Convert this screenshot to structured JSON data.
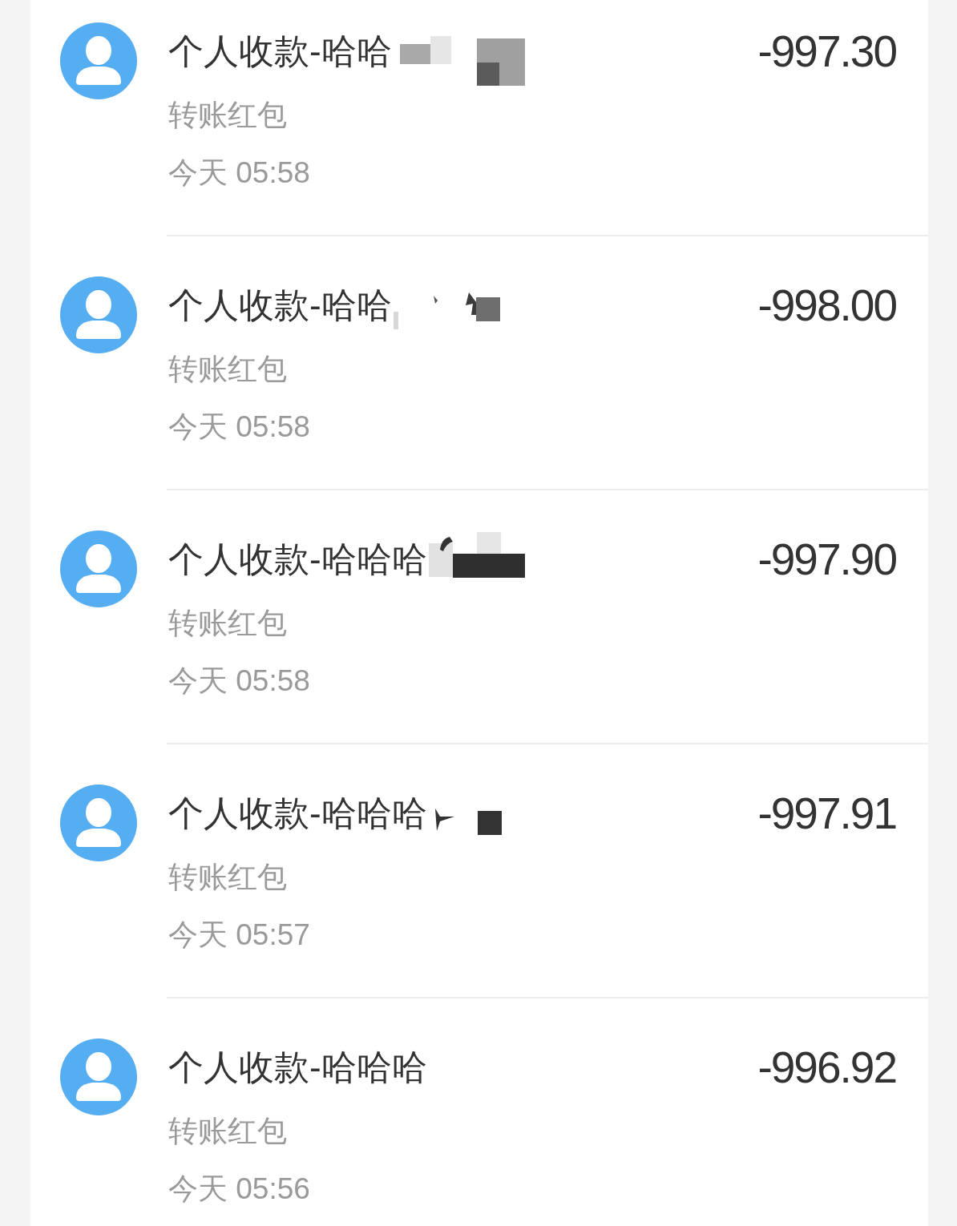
{
  "transactions": [
    {
      "title": "个人收款-哈哈",
      "redaction": {
        "kind": "mosaic"
      },
      "category": "转账红包",
      "time": "今天 05:58",
      "amount": "-997.30"
    },
    {
      "title": "个人收款-哈哈",
      "redaction": {
        "kind": "square"
      },
      "category": "转账红包",
      "time": "今天 05:58",
      "amount": "-998.00"
    },
    {
      "title": "个人收款-哈哈哈",
      "redaction": {
        "kind": "bar"
      },
      "category": "转账红包",
      "time": "今天 05:58",
      "amount": "-997.90"
    },
    {
      "title": "个人收款-哈哈哈",
      "redaction": {
        "kind": "smudge"
      },
      "category": "转账红包",
      "time": "今天 05:57",
      "amount": "-997.91"
    },
    {
      "title": "个人收款-哈哈哈",
      "category": "转账红包",
      "time": "今天 05:56",
      "amount": "-996.92"
    }
  ]
}
